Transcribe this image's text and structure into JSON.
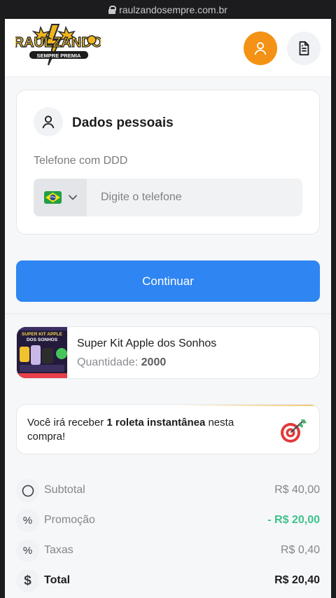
{
  "browser": {
    "url": "raulzandosempre.com.br"
  },
  "header": {
    "logo_title": "RAULZANDO",
    "logo_subtitle": "SEMPRE PREMIA"
  },
  "personal": {
    "title": "Dados pessoais",
    "phone_label": "Telefone com DDD",
    "phone_placeholder": "Digite o telefone",
    "phone_value": ""
  },
  "continue_label": "Continuar",
  "product": {
    "name": "Super Kit Apple dos Sonhos",
    "qty_label": "Quantidade:",
    "qty_value": "2000",
    "thumb_title": "SUPER KIT APPLE",
    "thumb_subtitle": "DOS SONHOS"
  },
  "roulette": {
    "text_before": "Você irá receber ",
    "text_bold": "1 roleta instantânea",
    "text_after": " nesta compra!"
  },
  "summary": {
    "subtotal_label": "Subtotal",
    "subtotal_value": "R$ 40,00",
    "promo_label": "Promoção",
    "promo_value": "- R$ 20,00",
    "fees_label": "Taxas",
    "fees_value": "R$ 0,40",
    "total_label": "Total",
    "total_value": "R$ 20,40"
  },
  "colors": {
    "accent_blue": "#2f85f2",
    "avatar_orange": "#f39214",
    "promo_green": "#3cc28b"
  },
  "icons": [
    "lock-icon",
    "user-icon",
    "document-icon",
    "brazil-flag-icon",
    "chevron-down-icon",
    "target-icon",
    "circle-icon",
    "percent-icon",
    "dollar-icon"
  ]
}
